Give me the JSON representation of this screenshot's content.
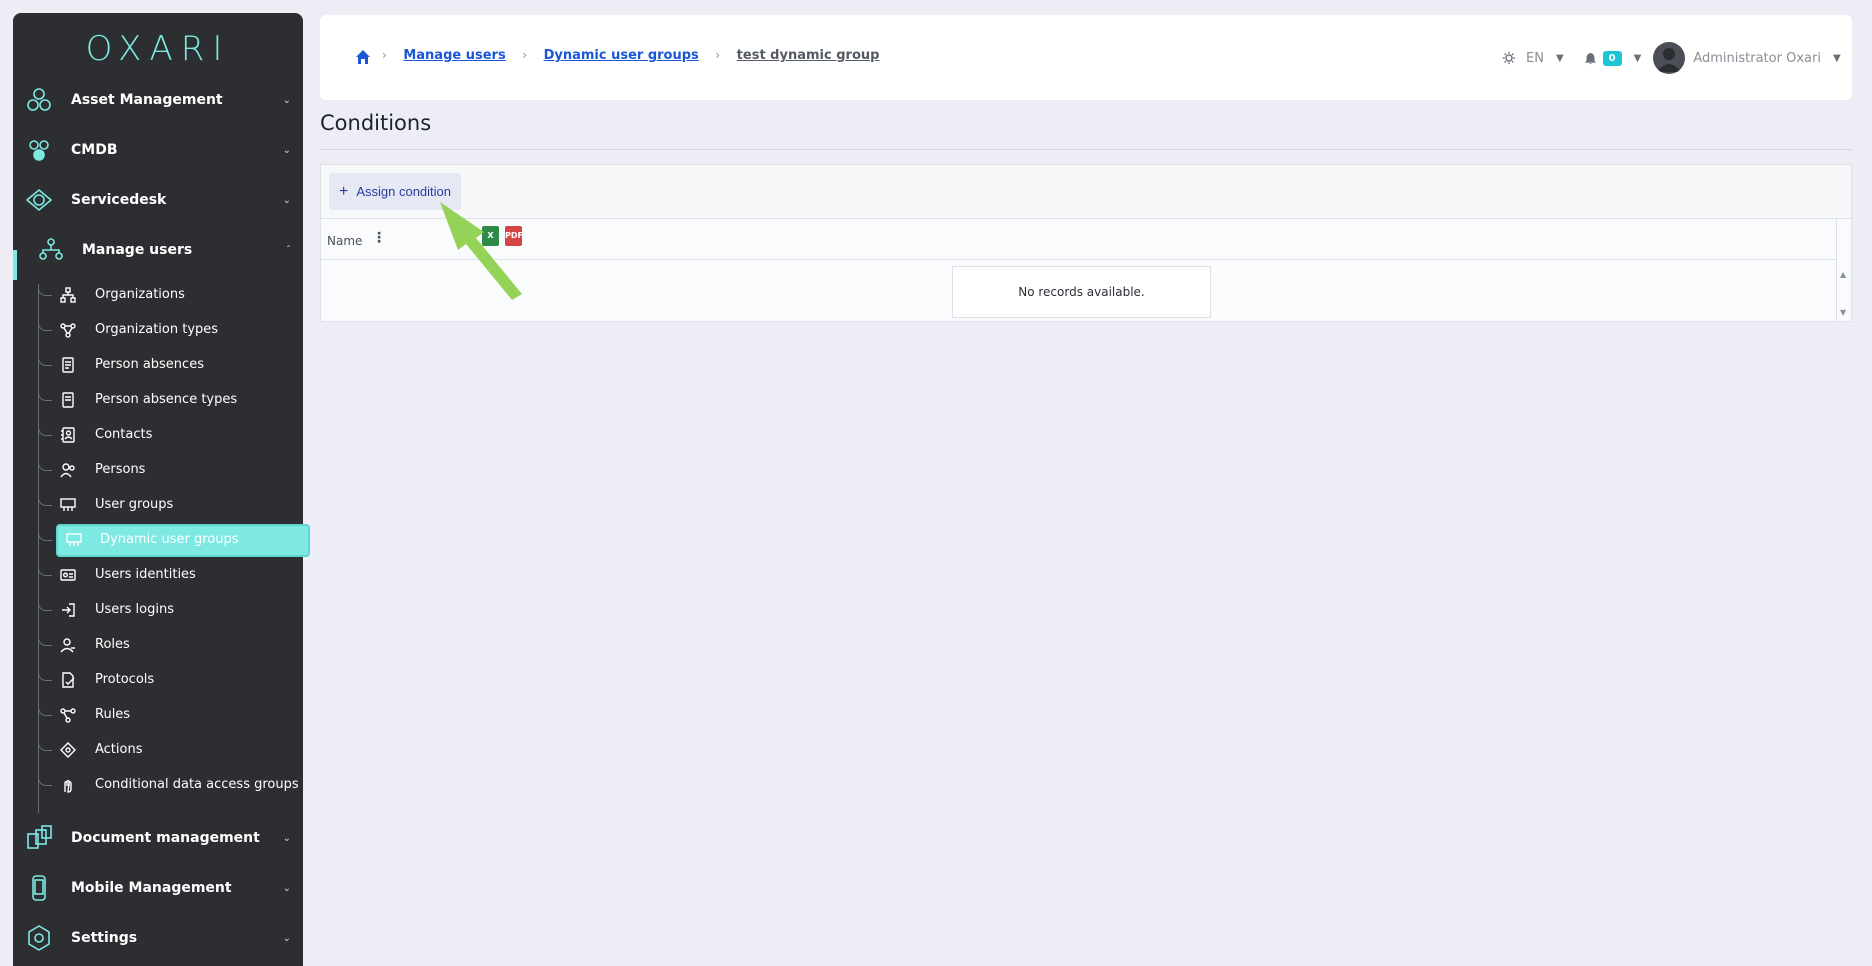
{
  "app": {
    "logo_text": "OXARI"
  },
  "sidebar": {
    "top_items": [
      {
        "label": "Asset Management",
        "icon": "hexagons-icon"
      },
      {
        "label": "CMDB",
        "icon": "cmdb-icon"
      },
      {
        "label": "Servicedesk",
        "icon": "eye-icon"
      },
      {
        "label": "Manage users",
        "icon": "users-tree-icon"
      },
      {
        "label": "Document management",
        "icon": "documents-icon"
      },
      {
        "label": "Mobile Management",
        "icon": "mobile-icon"
      },
      {
        "label": "Settings",
        "icon": "gear-icon"
      }
    ],
    "sub_items": [
      {
        "label": "Organizations",
        "icon": "org-chart-icon"
      },
      {
        "label": "Organization types",
        "icon": "org-types-icon"
      },
      {
        "label": "Person absences",
        "icon": "calendar-icon"
      },
      {
        "label": "Person absence types",
        "icon": "calendar-types-icon"
      },
      {
        "label": "Contacts",
        "icon": "contacts-icon"
      },
      {
        "label": "Persons",
        "icon": "persons-icon"
      },
      {
        "label": "User groups",
        "icon": "user-groups-icon"
      },
      {
        "label": "Dynamic user groups",
        "icon": "dynamic-groups-icon"
      },
      {
        "label": "Users identities",
        "icon": "id-card-icon"
      },
      {
        "label": "Users logins",
        "icon": "login-icon"
      },
      {
        "label": "Roles",
        "icon": "role-icon"
      },
      {
        "label": "Protocols",
        "icon": "protocol-icon"
      },
      {
        "label": "Rules",
        "icon": "rules-icon"
      },
      {
        "label": "Actions",
        "icon": "actions-icon"
      },
      {
        "label": "Conditional data access groups",
        "icon": "hand-icon"
      }
    ],
    "colors": {
      "bg": "#2c2e31",
      "accent": "#7ee8e3"
    }
  },
  "header": {
    "breadcrumb": [
      "Manage users",
      "Dynamic user groups",
      "test dynamic group"
    ],
    "language": "EN",
    "notifications_count": "0",
    "user_name": "Administrator Oxari"
  },
  "main": {
    "title": "Conditions",
    "assign_button": "Assign condition",
    "column_name": "Name",
    "empty_message": "No records available.",
    "export_xls": "X",
    "export_pdf": "PDF"
  }
}
